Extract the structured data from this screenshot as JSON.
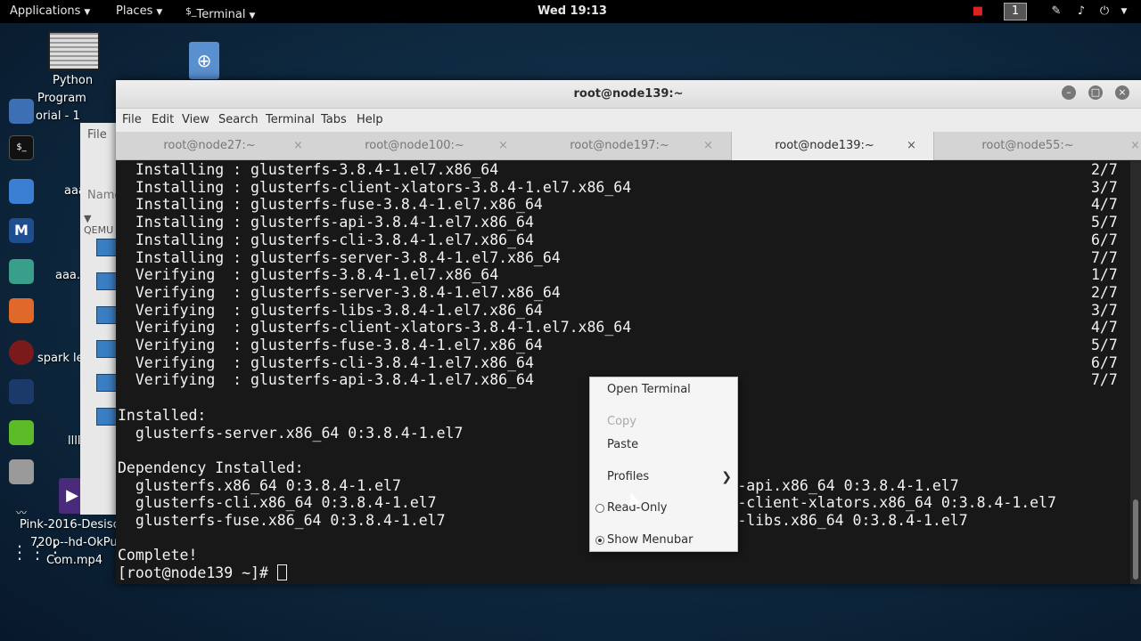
{
  "topbar": {
    "applications": "Applications",
    "places": "Places",
    "terminal_icon": "$_",
    "terminal_app": "Terminal",
    "clock": "Wed 19:13",
    "workspace": "1"
  },
  "desktop": {
    "icon_labels": [
      "Python",
      "Program",
      "orial - 1",
      "aaa",
      "aaa.t",
      "spark lea",
      "llll"
    ],
    "video_label_lines": [
      "Pink-2016-Desisc",
      "720p--hd-OkPunja",
      "Com.mp4"
    ]
  },
  "bg_filemanager": {
    "menu_file": "File",
    "column_name": "Name",
    "folder": "QEMU"
  },
  "terminal": {
    "title": "root@node139:~",
    "menu": [
      "File",
      "Edit",
      "View",
      "Search",
      "Terminal",
      "Tabs",
      "Help"
    ],
    "tabs": [
      {
        "label": "root@node27:~"
      },
      {
        "label": "root@node100:~"
      },
      {
        "label": "root@node197:~"
      },
      {
        "label": "root@node139:~"
      },
      {
        "label": "root@node55:~"
      }
    ],
    "active_tab": 3,
    "lines": [
      {
        "text": "  Installing : glusterfs-3.8.4-1.el7.x86_64",
        "count": "2/7"
      },
      {
        "text": "  Installing : glusterfs-client-xlators-3.8.4-1.el7.x86_64",
        "count": "3/7"
      },
      {
        "text": "  Installing : glusterfs-fuse-3.8.4-1.el7.x86_64",
        "count": "4/7"
      },
      {
        "text": "  Installing : glusterfs-api-3.8.4-1.el7.x86_64",
        "count": "5/7"
      },
      {
        "text": "  Installing : glusterfs-cli-3.8.4-1.el7.x86_64",
        "count": "6/7"
      },
      {
        "text": "  Installing : glusterfs-server-3.8.4-1.el7.x86_64",
        "count": "7/7"
      },
      {
        "text": "  Verifying  : glusterfs-3.8.4-1.el7.x86_64",
        "count": "1/7"
      },
      {
        "text": "  Verifying  : glusterfs-server-3.8.4-1.el7.x86_64",
        "count": "2/7"
      },
      {
        "text": "  Verifying  : glusterfs-libs-3.8.4-1.el7.x86_64",
        "count": "3/7"
      },
      {
        "text": "  Verifying  : glusterfs-client-xlators-3.8.4-1.el7.x86_64",
        "count": "4/7"
      },
      {
        "text": "  Verifying  : glusterfs-fuse-3.8.4-1.el7.x86_64",
        "count": "5/7"
      },
      {
        "text": "  Verifying  : glusterfs-cli-3.8.4-1.el7.x86_64",
        "count": "6/7"
      },
      {
        "text": "  Verifying  : glusterfs-api-3.8.4-1.el7.x86_64",
        "count": "7/7"
      },
      {
        "text": "",
        "count": ""
      },
      {
        "text": "Installed:",
        "count": ""
      },
      {
        "text": "  glusterfs-server.x86_64 0:3.8.4-1.el7",
        "count": ""
      },
      {
        "text": "",
        "count": ""
      },
      {
        "text": "Dependency Installed:",
        "count": ""
      },
      {
        "text": "  glusterfs.x86_64 0:3.8.4-1.el7                             glusterfs-api.x86_64 0:3.8.4-1.el7",
        "count": ""
      },
      {
        "text": "  glusterfs-cli.x86_64 0:3.8.4-1.el7                         glusterfs-client-xlators.x86_64 0:3.8.4-1.el7",
        "count": ""
      },
      {
        "text": "  glusterfs-fuse.x86_64 0:3.8.4-1.el7                        glusterfs-libs.x86_64 0:3.8.4-1.el7",
        "count": ""
      },
      {
        "text": "",
        "count": ""
      },
      {
        "text": "Complete!",
        "count": ""
      },
      {
        "text": "[root@node139 ~]# ",
        "count": ""
      }
    ]
  },
  "context_menu": {
    "open_terminal": "Open Terminal",
    "copy": "Copy",
    "paste": "Paste",
    "profiles": "Profiles",
    "read_only": "Read-Only",
    "show_menubar": "Show Menubar",
    "read_only_checked": false,
    "show_menubar_checked": true
  },
  "colors": {
    "terminal_bg": "#181818",
    "desktop_bg": "#0f2c44",
    "topbar_bg": "#000000"
  }
}
